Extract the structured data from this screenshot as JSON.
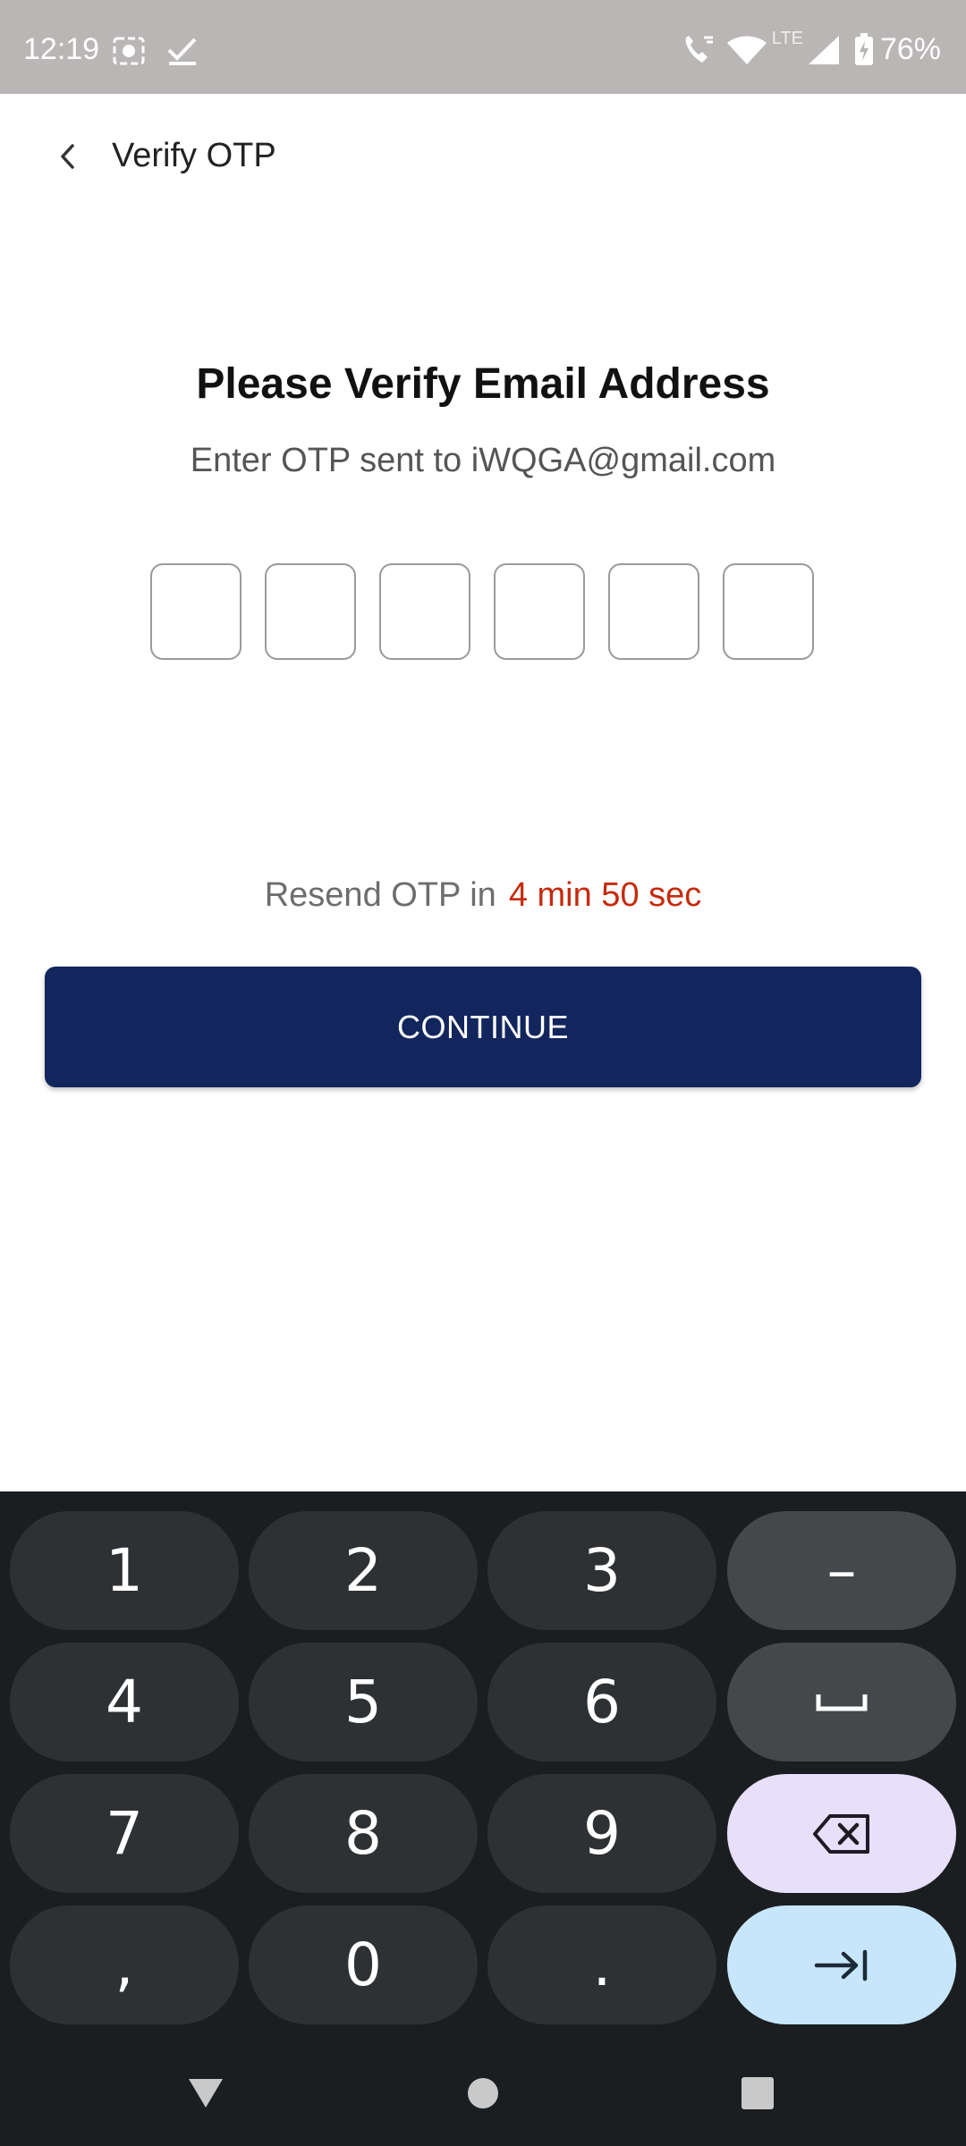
{
  "status_bar": {
    "time": "12:19",
    "network_label": "LTE",
    "battery": "76%"
  },
  "app_bar": {
    "title": "Verify OTP",
    "back_icon": "chevron-left-icon"
  },
  "content": {
    "heading": "Please Verify Email Address",
    "subheading": "Enter OTP sent to iWQGA@gmail.com",
    "otp_boxes": [
      "",
      "",
      "",
      "",
      "",
      ""
    ],
    "resend_label": "Resend OTP in",
    "resend_timer": "4 min 50 sec",
    "continue_label": "CONTINUE"
  },
  "keyboard": {
    "row1": [
      "1",
      "2",
      "3",
      "–"
    ],
    "row2": [
      "4",
      "5",
      "6",
      "space"
    ],
    "row3": [
      "7",
      "8",
      "9",
      "backspace"
    ],
    "row4": [
      ",",
      "0",
      ".",
      "enter"
    ]
  },
  "colors": {
    "accent": "#12265d",
    "timer": "#c62a0c",
    "status_bar": "#b9b6b5",
    "keyboard_bg": "#1b1e21"
  }
}
